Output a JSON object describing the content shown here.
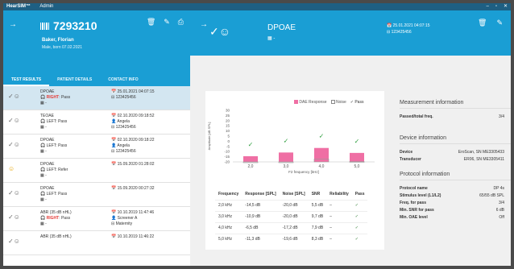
{
  "titlebar": {
    "app": "HearSIM™",
    "user": "Admin",
    "min": "–",
    "max": "▫",
    "close": "✕"
  },
  "patient": {
    "id": "7293210",
    "name": "Baker, Florian",
    "born": "Male, born 07.02.2021"
  },
  "tabs": [
    "TEST RESULTS",
    "PATIENT DETAILS",
    "CONTACT INFO"
  ],
  "tests": [
    {
      "type": "DPOAE",
      "side": "RIGHT",
      "result": "Pass",
      "extra": "",
      "date": "25.01.2021 04:07:15",
      "l2": "123425456",
      "l3": "",
      "mark": "✓",
      "state": "sel"
    },
    {
      "type": "TEOAE",
      "side": "LEFT",
      "result": "Pass",
      "extra": "",
      "date": "02.10.2020 09:18:52",
      "l2": "Angela",
      "l3": "123425456",
      "mark": "✓",
      "state": ""
    },
    {
      "type": "DPOAE",
      "side": "LEFT",
      "result": "Pass",
      "extra": "",
      "date": "02.10.2020 09:18:22",
      "l2": "Angela",
      "l3": "123425456",
      "mark": "✓",
      "state": ""
    },
    {
      "type": "DPOAE",
      "side": "LEFT",
      "result": "Refer",
      "extra": "",
      "date": "15.09.2020 01:28:02",
      "l2": "",
      "l3": "",
      "mark": "!",
      "state": ""
    },
    {
      "type": "DPOAE",
      "side": "LEFT",
      "result": "Pass",
      "extra": "",
      "date": "15.09.2020 00:27:32",
      "l2": "",
      "l3": "",
      "mark": "✓",
      "state": ""
    },
    {
      "type": "ABR (35 dB nHL)",
      "side": "RIGHT",
      "result": "Pass",
      "extra": "",
      "date": "10.10.2019 11:47:46",
      "l2": "Screener A",
      "l3": "Maternity",
      "mark": "✓",
      "state": ""
    },
    {
      "type": "ABR (35 dB nHL)",
      "side": "",
      "result": "",
      "extra": "",
      "date": "10.10.2019 11:46:22",
      "l2": "",
      "l3": "",
      "mark": "",
      "state": ""
    }
  ],
  "detail": {
    "title": "DPOAE",
    "date": "25.01.2021 04:07:15",
    "serial": "123425456"
  },
  "legend": {
    "dae": "DAE Response",
    "noise": "Noise",
    "pass": "✓ Pass"
  },
  "chart_data": {
    "type": "bar",
    "categories": [
      "2,0",
      "3,0",
      "4,0",
      "5,0"
    ],
    "series": [
      {
        "name": "DAE Response",
        "values": [
          -14.5,
          -10.9,
          -6.5,
          -11.3
        ]
      },
      {
        "name": "Noise",
        "values": [
          -20.0,
          -20.0,
          -17.2,
          -19.6
        ]
      }
    ],
    "pass": [
      true,
      true,
      true,
      true
    ],
    "xlabel": "F2 frequency [kHz]",
    "ylabel": "Amplitude [dB SPL]",
    "yticks": [
      30,
      25,
      20,
      15,
      10,
      5,
      0,
      -5,
      -10,
      -15,
      -20
    ],
    "ylim": [
      -20,
      30
    ]
  },
  "table": {
    "headers": [
      "Frequency",
      "Response [SPL]",
      "Noise [SPL]",
      "SNR",
      "Reliability",
      "Pass"
    ],
    "rows": [
      [
        "2,0 kHz",
        "-14,5 dB",
        "-20,0 dB",
        "5,5 dB",
        "–",
        "✓"
      ],
      [
        "3,0 kHz",
        "-10,9 dB",
        "-20,0 dB",
        "9,7 dB",
        "–",
        "✓"
      ],
      [
        "4,0 kHz",
        "-6,5 dB",
        "-17,2 dB",
        "7,9 dB",
        "–",
        "✓"
      ],
      [
        "5,0 kHz",
        "-11,3 dB",
        "-19,6 dB",
        "8,3 dB",
        "–",
        "✓"
      ]
    ]
  },
  "info": {
    "meas_h": "Measurement information",
    "passed_k": "Passed/total freq.",
    "passed_v": "3/4",
    "dev_h": "Device information",
    "dev_k": "Device",
    "dev_v": "EroScan, SN ME3305433",
    "trans_k": "Transducer",
    "trans_v": "ER06, SN ME3305411",
    "proto_h": "Protocol information",
    "p1k": "Protocol name",
    "p1v": "DP 4s",
    "p2k": "Stimulus level (L1/L2)",
    "p2v": "65/55 dB SPL",
    "p3k": "Freq. for pass",
    "p3v": "3/4",
    "p4k": "Min. SNR for pass",
    "p4v": "6 dB",
    "p5k": "Min. OAE level",
    "p5v": "Off"
  }
}
